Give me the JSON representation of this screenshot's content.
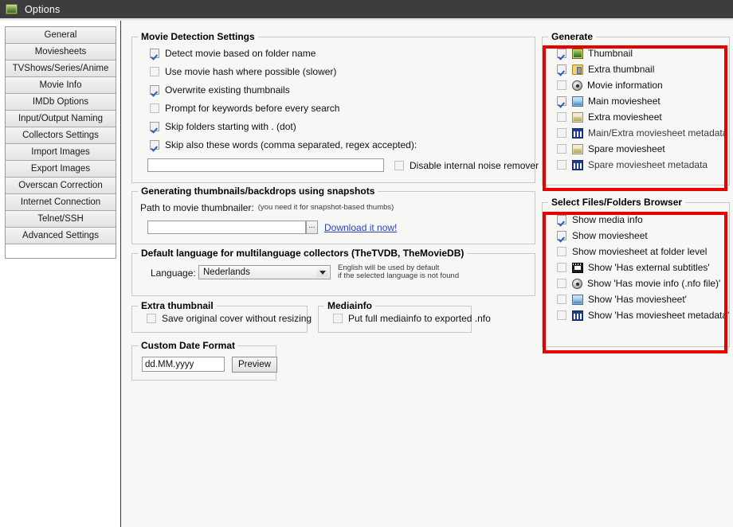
{
  "window": {
    "title": "Options",
    "icon": "picture-icon"
  },
  "sidebar": {
    "items": [
      {
        "label": "General"
      },
      {
        "label": "Moviesheets"
      },
      {
        "label": "TVShows/Series/Anime"
      },
      {
        "label": "Movie Info"
      },
      {
        "label": "IMDb Options"
      },
      {
        "label": "Input/Output Naming"
      },
      {
        "label": "Collectors Settings"
      },
      {
        "label": "Import Images"
      },
      {
        "label": "Export Images"
      },
      {
        "label": "Overscan Correction"
      },
      {
        "label": "Internet Connection"
      },
      {
        "label": "Telnet/SSH"
      },
      {
        "label": "Advanced Settings"
      }
    ]
  },
  "movie_detection": {
    "legend": "Movie Detection Settings",
    "options": [
      {
        "label": "Detect movie based on folder name",
        "checked": true
      },
      {
        "label": "Use movie hash where possible (slower)",
        "checked": false
      },
      {
        "label": "Overwrite existing thumbnails",
        "checked": true
      },
      {
        "label": "Prompt for keywords before every search",
        "checked": false
      },
      {
        "label": "Skip folders starting with . (dot)",
        "checked": true
      },
      {
        "label": "Skip also these words (comma separated, regex accepted):",
        "checked": true
      }
    ],
    "skip_words_value": "",
    "skip_words_placeholder": "",
    "noise_remover": {
      "label": "Disable internal noise remover",
      "checked": false
    }
  },
  "snapshots": {
    "legend": "Generating thumbnails/backdrops using snapshots",
    "path_label": "Path to movie thumbnailer:",
    "path_hint": "(you need it for snapshot-based thumbs)",
    "path_value": "",
    "browse_label": "...",
    "download_link": "Download it now!"
  },
  "language": {
    "legend": "Default language for multilanguage collectors (TheTVDB, TheMovieDB)",
    "field_label": "Language:",
    "selected": "Nederlands",
    "note_line1": "English will be used by default",
    "note_line2": "if the selected language is not found"
  },
  "extra_thumbnail": {
    "legend": "Extra thumbnail",
    "option": {
      "label": "Save original cover without resizing",
      "checked": false
    }
  },
  "mediainfo": {
    "legend": "Mediainfo",
    "option": {
      "label": "Put full mediainfo to exported .nfo",
      "checked": false
    }
  },
  "custom_date_format": {
    "legend": "Custom Date Format",
    "value": "dd.MM.yyyy",
    "preview_label": "Preview"
  },
  "generate": {
    "legend": "Generate",
    "highlight_color": "#e80000",
    "items": [
      {
        "label": "Thumbnail",
        "checked": true,
        "enabled": true,
        "icon": "picture-icon"
      },
      {
        "label": "Extra thumbnail",
        "checked": true,
        "enabled": true,
        "icon": "folder-picture-icon"
      },
      {
        "label": "Movie information",
        "checked": false,
        "enabled": true,
        "icon": "film-reel-icon"
      },
      {
        "label": "Main moviesheet",
        "checked": true,
        "enabled": true,
        "icon": "moviesheet-icon"
      },
      {
        "label": "Extra moviesheet",
        "checked": false,
        "enabled": true,
        "icon": "moviesheet-alt-icon"
      },
      {
        "label": "Main/Extra moviesheet metadata",
        "checked": false,
        "enabled": false,
        "icon": "metadata-icon"
      },
      {
        "label": "Spare moviesheet",
        "checked": false,
        "enabled": true,
        "icon": "moviesheet-alt-icon"
      },
      {
        "label": "Spare moviesheet metadata",
        "checked": false,
        "enabled": false,
        "icon": "metadata-icon"
      }
    ]
  },
  "browser": {
    "legend": "Select Files/Folders Browser",
    "highlight_color": "#e80000",
    "items": [
      {
        "label": "Show media info",
        "checked": true,
        "icon": null
      },
      {
        "label": "Show moviesheet",
        "checked": true,
        "icon": null
      },
      {
        "label": "Show moviesheet at folder level",
        "checked": false,
        "icon": null
      },
      {
        "label": "Show 'Has external subtitles'",
        "checked": false,
        "icon": "subtitles-icon"
      },
      {
        "label": "Show 'Has movie info (.nfo file)'",
        "checked": false,
        "icon": "film-reel-icon"
      },
      {
        "label": "Show 'Has moviesheet'",
        "checked": false,
        "icon": "moviesheet-icon"
      },
      {
        "label": "Show 'Has moviesheet metadata'",
        "checked": false,
        "icon": "metadata-icon"
      }
    ]
  }
}
